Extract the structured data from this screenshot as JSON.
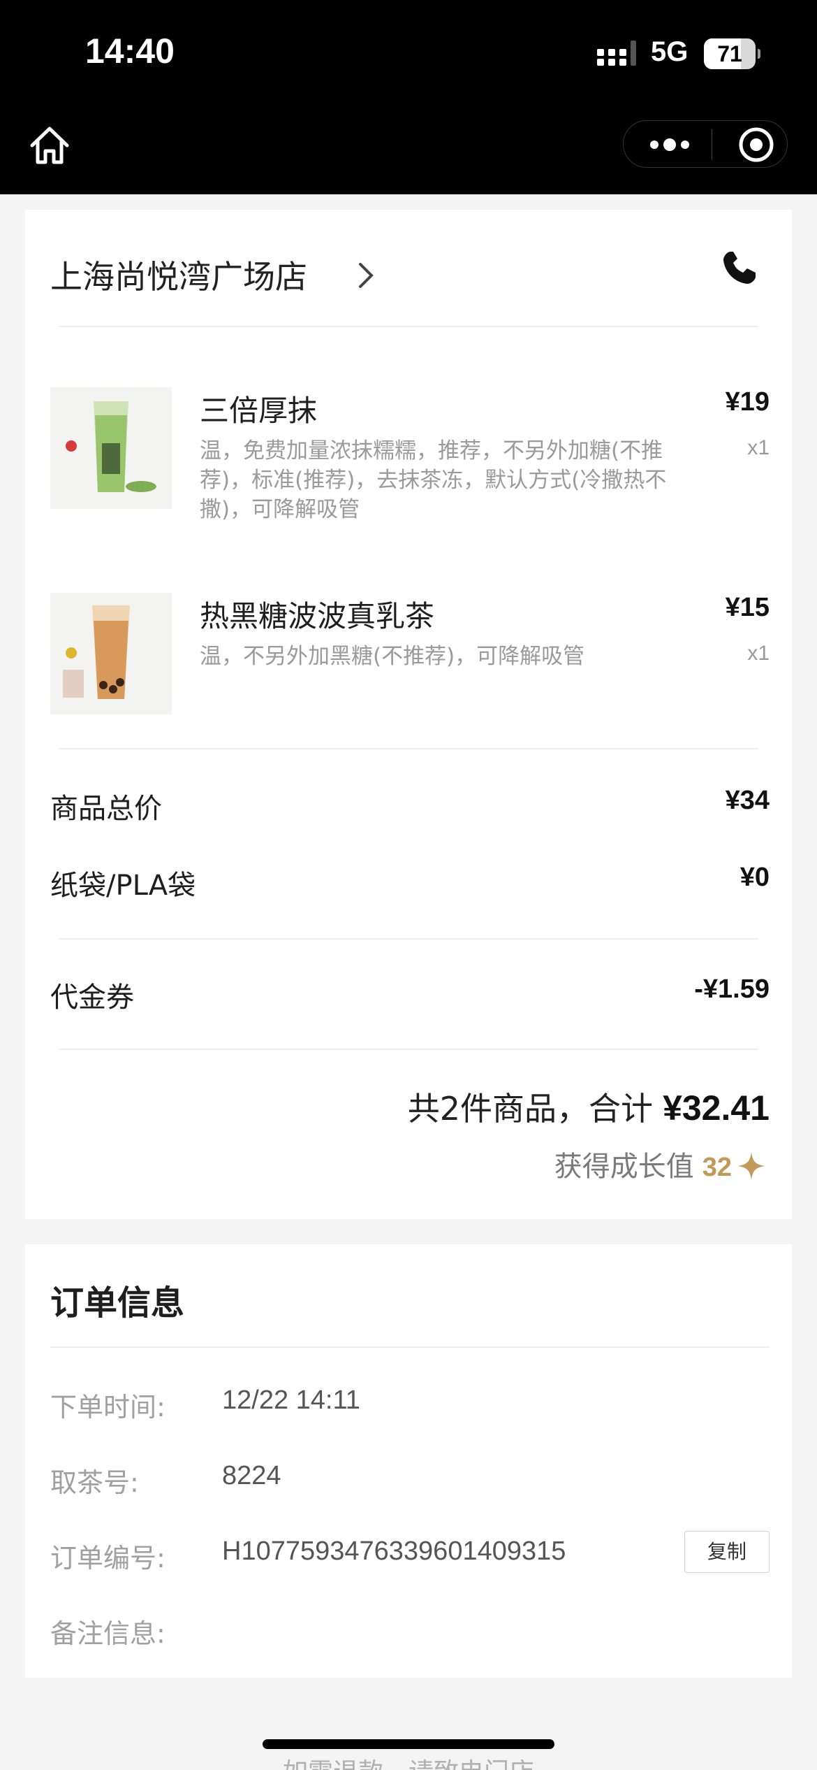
{
  "status_bar": {
    "time": "14:40",
    "network": "5G",
    "battery": "71",
    "battery_level": 0.71
  },
  "nav": {
    "home_icon": "home-icon",
    "more_icon": "more-dots-icon",
    "close_icon": "target-circle-icon"
  },
  "store": {
    "name": "上海尚悦湾广场店",
    "chevron_icon": "chevron-right-icon",
    "phone_icon": "phone-icon"
  },
  "items": [
    {
      "name": "三倍厚抹",
      "price": "¥19",
      "qty": "x1",
      "desc": "温，免费加量浓抹糯糯，推荐，不另外加糖(不推荐)，标准(推荐)，去抹茶冻，默认方式(冷撒热不撒)，可降解吸管",
      "accent": "#8fc56a"
    },
    {
      "name": "热黑糖波波真乳茶",
      "price": "¥15",
      "qty": "x1",
      "desc": "温，不另外加黑糖(不推荐)，可降解吸管",
      "accent": "#c9874a"
    }
  ],
  "summary": {
    "subtotal_label": "商品总价",
    "subtotal_value": "¥34",
    "bag_label": "纸袋/PLA袋",
    "bag_value": "¥0",
    "coupon_label": "代金券",
    "coupon_value": "-¥1.59",
    "total_count": "共2件商品，合计",
    "total_amount": "¥32.41",
    "growth_label": "获得成长值",
    "growth_value": "32",
    "growth_color": "#c29a57"
  },
  "order_info": {
    "title": "订单信息",
    "rows": [
      {
        "label": "下单时间:",
        "value": "12/22 14:11"
      },
      {
        "label": "取茶号:",
        "value": "8224"
      },
      {
        "label": "订单编号:",
        "value": "H10775934763396014093​15"
      },
      {
        "label": "备注信息:",
        "value": ""
      }
    ],
    "copy_label": "复制"
  },
  "footer": {
    "note": "如需退款，请致电门店"
  }
}
